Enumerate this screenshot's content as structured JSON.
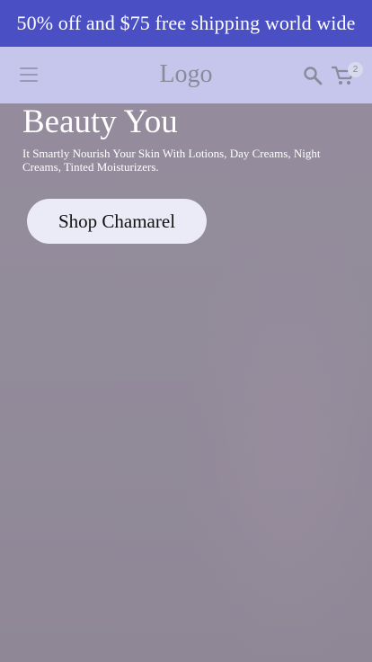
{
  "announcement": {
    "text": "50% off and $75 free shipping world wide"
  },
  "header": {
    "logo": "Logo",
    "menu_icon": "hamburger-menu-icon",
    "search_icon": "search-icon",
    "cart_icon": "shopping-cart-icon",
    "cart_count": "2"
  },
  "hero": {
    "title": "Beauty You",
    "subtitle": "It Smartly Nourish Your Skin With Lotions, Day Creams, Night Creams, Tinted Moisturizers.",
    "cta_label": "Shop Chamarel"
  },
  "colors": {
    "announcement_bg": "#4b4fc4",
    "header_bg": "#c6c6ec",
    "hero_bg": "#928b9a",
    "button_bg": "#ebebf8"
  }
}
